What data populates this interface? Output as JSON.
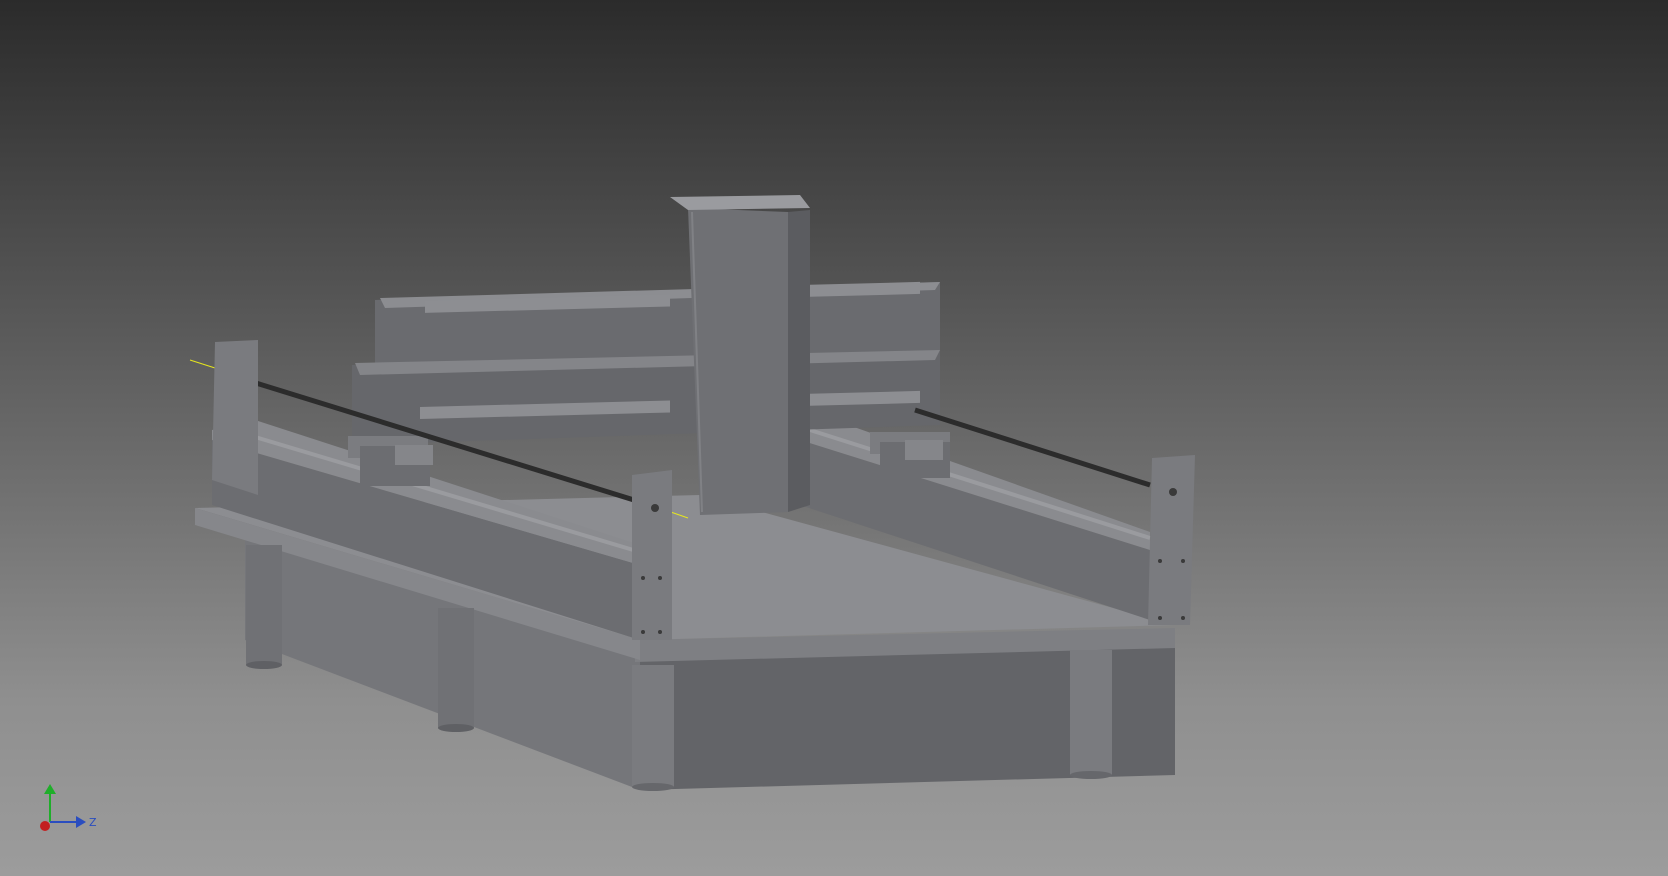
{
  "viewport": {
    "background_top": "#2b2b2b",
    "background_bottom": "#9c9c9c"
  },
  "model": {
    "part_color": "#6e6f73",
    "highlight_color": "#8a8b8f",
    "shadow_color": "#55565a",
    "rod_color": "#2c2c2c",
    "axis_line_color": "#e6e61e"
  },
  "triad": {
    "y_color": "#1fae2a",
    "z_color": "#2a4dbf",
    "x_color": "#c22020",
    "z_label": "Z"
  }
}
